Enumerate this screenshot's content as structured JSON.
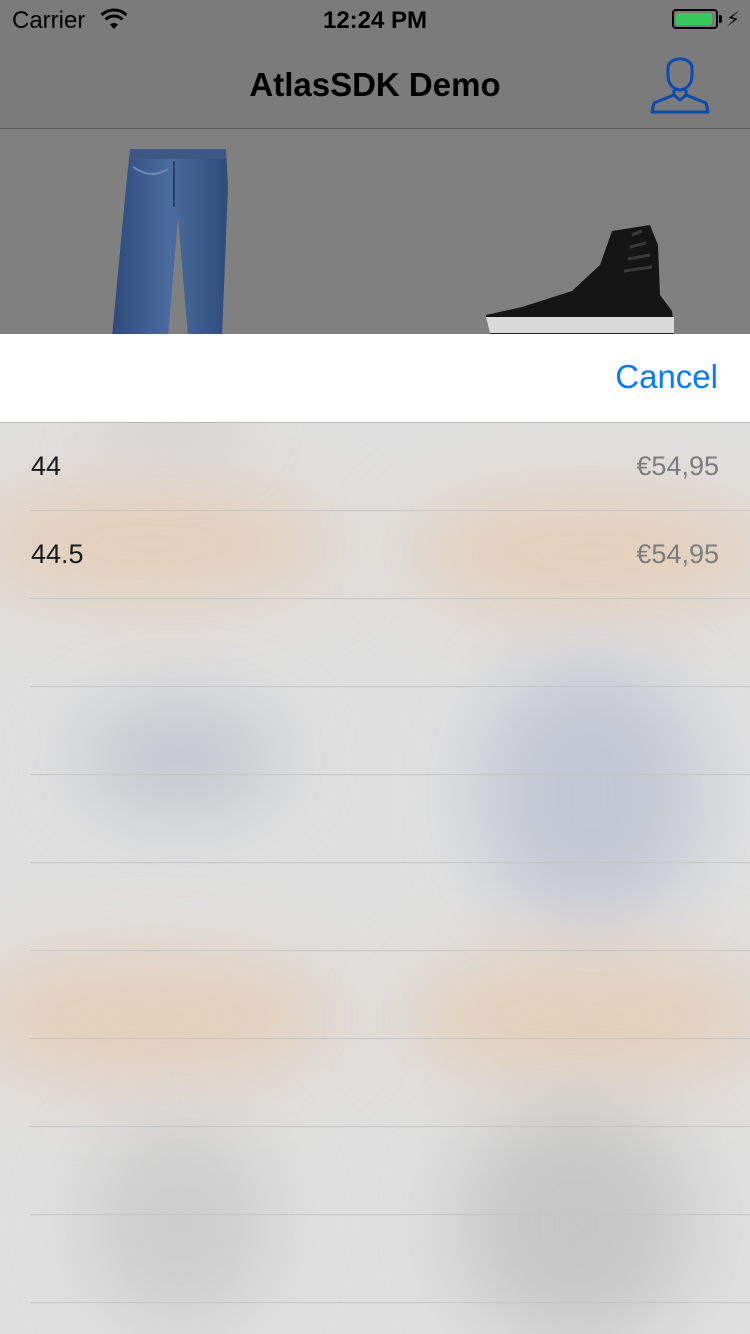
{
  "status_bar": {
    "carrier": "Carrier",
    "time": "12:24 PM",
    "battery_color": "#35c759",
    "battery_level": 0.95
  },
  "nav": {
    "title": "AtlasSDK Demo",
    "profile_icon": "user-profile-icon",
    "accent_color": "#0a4bb0"
  },
  "products": [
    {
      "name_icon": "jeans-product-image"
    },
    {
      "name_icon": "sneaker-product-image"
    }
  ],
  "sheet": {
    "cancel_label": "Cancel",
    "accent_color": "#0a7aff",
    "sizes": [
      {
        "size": "44",
        "price": "€54,95"
      },
      {
        "size": "44.5",
        "price": "€54,95"
      },
      {
        "size": "",
        "price": ""
      },
      {
        "size": "",
        "price": ""
      },
      {
        "size": "",
        "price": ""
      },
      {
        "size": "",
        "price": ""
      },
      {
        "size": "",
        "price": ""
      },
      {
        "size": "",
        "price": ""
      },
      {
        "size": "",
        "price": ""
      },
      {
        "size": "",
        "price": ""
      }
    ]
  }
}
